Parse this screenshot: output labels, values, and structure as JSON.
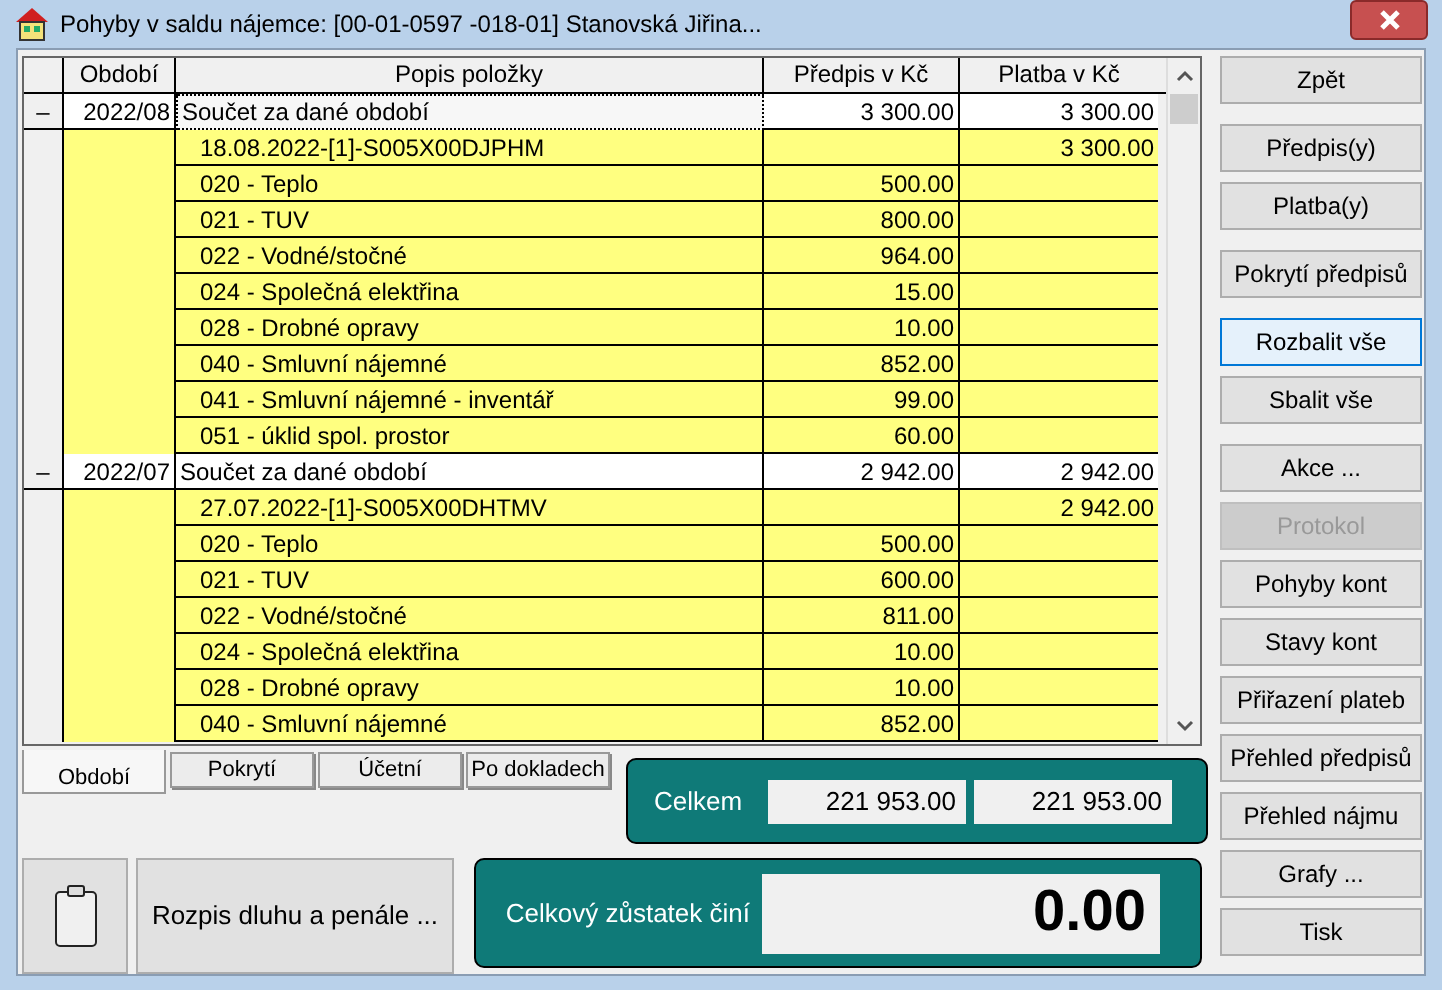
{
  "window": {
    "title": "Pohyby v saldu nájemce: [00-01-0597 -018-01]  Stanovská Jiřina..."
  },
  "table": {
    "columns": [
      "Období",
      "Popis položky",
      "Předpis v Kč",
      "Platba v Kč"
    ],
    "groups": [
      {
        "toggle": "–",
        "expanded": true,
        "selected": true,
        "period": "2022/08",
        "desc": "Součet za dané období",
        "predpis": "3 300.00",
        "platba": "3 300.00",
        "items": [
          {
            "desc": "18.08.2022-[1]-S005X00DJPHM",
            "platba": "3 300.00"
          },
          {
            "desc": "020 - Teplo",
            "predpis": "500.00"
          },
          {
            "desc": "021 - TUV",
            "predpis": "800.00"
          },
          {
            "desc": "022 - Vodné/stočné",
            "predpis": "964.00"
          },
          {
            "desc": "024 - Společná elektřina",
            "predpis": "15.00"
          },
          {
            "desc": "028 - Drobné opravy",
            "predpis": "10.00"
          },
          {
            "desc": "040 - Smluvní nájemné",
            "predpis": "852.00"
          },
          {
            "desc": "041 - Smluvní nájemné - inventář",
            "predpis": "99.00"
          },
          {
            "desc": "051 - úklid spol. prostor",
            "predpis": "60.00"
          }
        ]
      },
      {
        "toggle": "–",
        "expanded": true,
        "selected": false,
        "period": "2022/07",
        "desc": "Součet za dané období",
        "predpis": "2 942.00",
        "platba": "2 942.00",
        "items": [
          {
            "desc": "27.07.2022-[1]-S005X00DHTMV",
            "platba": "2 942.00"
          },
          {
            "desc": "020 - Teplo",
            "predpis": "500.00"
          },
          {
            "desc": "021 - TUV",
            "predpis": "600.00"
          },
          {
            "desc": "022 - Vodné/stočné",
            "predpis": "811.00"
          },
          {
            "desc": "024 - Společná elektřina",
            "predpis": "10.00"
          },
          {
            "desc": "028 - Drobné opravy",
            "predpis": "10.00"
          },
          {
            "desc": "040 - Smluvní nájemné",
            "predpis": "852.00"
          }
        ]
      }
    ]
  },
  "tabs": [
    {
      "label": "Období",
      "selected": true
    },
    {
      "label": "Pokrytí",
      "selected": false
    },
    {
      "label": "Účetní",
      "selected": false
    },
    {
      "label": "Po dokladech",
      "selected": false
    }
  ],
  "totals": {
    "label": "Celkem",
    "predpis": "221 953.00",
    "platba": "221 953.00"
  },
  "debt_button": "Rozpis dluhu a penále ...",
  "balance": {
    "label": "Celkový zůstatek činí",
    "value": "0.00"
  },
  "button_groups": [
    [
      {
        "label": "Zpět",
        "disabled": false,
        "focused": false
      }
    ],
    [
      {
        "label": "Předpis(y)",
        "disabled": false,
        "focused": false
      },
      {
        "label": "Platba(y)",
        "disabled": false,
        "focused": false
      }
    ],
    [
      {
        "label": "Pokrytí předpisů",
        "disabled": false,
        "focused": false
      }
    ],
    [
      {
        "label": "Rozbalit vše",
        "disabled": false,
        "focused": true
      },
      {
        "label": "Sbalit vše",
        "disabled": false,
        "focused": false
      }
    ],
    [
      {
        "label": "Akce ...",
        "disabled": false,
        "focused": false
      },
      {
        "label": "Protokol",
        "disabled": true,
        "focused": false
      },
      {
        "label": "Pohyby kont",
        "disabled": false,
        "focused": false
      },
      {
        "label": "Stavy kont",
        "disabled": false,
        "focused": false
      },
      {
        "label": "Přiřazení plateb",
        "disabled": false,
        "focused": false
      },
      {
        "label": "Přehled předpisů",
        "disabled": false,
        "focused": false
      },
      {
        "label": "Přehled nájmu",
        "disabled": false,
        "focused": false
      },
      {
        "label": "Grafy ...",
        "disabled": false,
        "focused": false
      },
      {
        "label": "Tisk",
        "disabled": false,
        "focused": false
      }
    ]
  ]
}
